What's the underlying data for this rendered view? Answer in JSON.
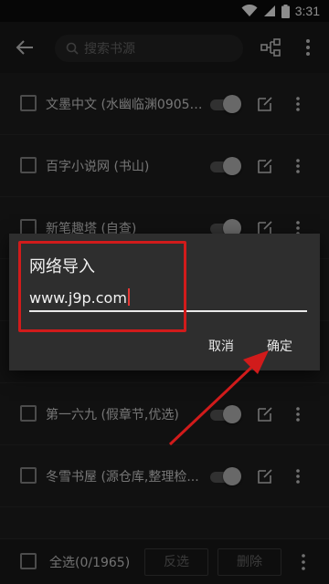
{
  "status_bar": {
    "time": "3:31",
    "icons": [
      "wifi-icon",
      "signal-icon",
      "battery-icon"
    ]
  },
  "toolbar": {
    "back_icon": "arrow-left-icon",
    "search_placeholder": "搜索书源",
    "tree_icon": "tree-structure-icon",
    "more_icon": "more-vertical-icon"
  },
  "list": {
    "items": [
      {
        "label": "文墨中文 (水幽临渊0905,...",
        "enabled": true
      },
      {
        "label": "百字小说网 (书山)",
        "enabled": true
      },
      {
        "label": "新笔趣塔 (自查)",
        "enabled": true
      },
      {
        "label": "",
        "enabled": true
      },
      {
        "label": "",
        "enabled": true
      },
      {
        "label": "第一六九 (假章节,优选)",
        "enabled": true
      },
      {
        "label": "冬雪书屋 (源仓库,整理检...",
        "enabled": true
      }
    ]
  },
  "bottom_bar": {
    "select_all_label": "全选(0/1965)",
    "invert_label": "反选",
    "delete_label": "删除"
  },
  "dialog": {
    "title": "网络导入",
    "input_value": "www.j9p.com",
    "cancel_label": "取消",
    "ok_label": "确定"
  },
  "colors": {
    "annotation_red": "#d11b1b",
    "caret_red": "#e53935",
    "dialog_bg": "#2e2e2e",
    "list_bg": "#1f1f1f"
  }
}
